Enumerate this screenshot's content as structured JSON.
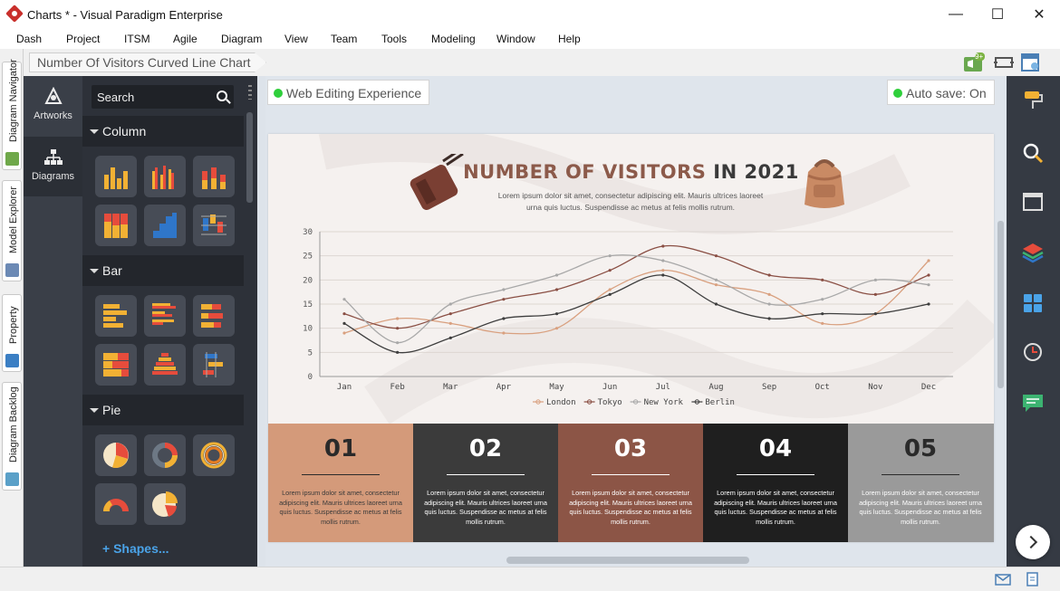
{
  "window": {
    "title": "Charts * - Visual Paradigm Enterprise"
  },
  "menu": [
    "Dash",
    "Project",
    "ITSM",
    "Agile",
    "Diagram",
    "View",
    "Team",
    "Tools",
    "Modeling",
    "Window",
    "Help"
  ],
  "left_tabs": [
    "Diagram Navigator",
    "Model Explorer",
    "Property",
    "Diagram Backlog"
  ],
  "breadcrumb": "Number Of Visitors Curved Line Chart",
  "toolbar": {
    "notification_badge": "9+"
  },
  "side_nav": [
    {
      "label": "Artworks",
      "icon": "artworks-icon"
    },
    {
      "label": "Diagrams",
      "icon": "diagrams-icon",
      "active": true
    }
  ],
  "search": {
    "placeholder": "Search"
  },
  "categories": [
    {
      "name": "Column",
      "tiles": 6
    },
    {
      "name": "Bar",
      "tiles": 6
    },
    {
      "name": "Pie",
      "tiles": 5
    }
  ],
  "shapes_link": "Shapes...",
  "status": {
    "web_editing": "Web Editing Experience",
    "autosave": "Auto save: On"
  },
  "infographic": {
    "title_main": "NUMBER OF VISITORS",
    "title_year": "IN 2021",
    "subtitle": "Lorem ipsum dolor sit amet, consectetur adipiscing elit. Mauris ultrices laoreet urna quis luctus. Suspendisse ac metus at felis mollis rutrum.",
    "cards": [
      {
        "number": "01",
        "text": "Lorem ipsum dolor sit amet, consectetur adipiscing elit. Mauris ultrices laoreet urna quis luctus. Suspendisse ac metus at felis mollis rutrum.",
        "bg": "#d49a7a",
        "fg": "#2a2a2a",
        "body": "#3a3a3a"
      },
      {
        "number": "02",
        "text": "Lorem ipsum dolor sit amet, consectetur adipiscing elit. Mauris ultrices laoreet urna quis luctus. Suspendisse ac metus at felis mollis rutrum.",
        "bg": "#3b3b3b",
        "fg": "#ffffff",
        "body": "#ffffff"
      },
      {
        "number": "03",
        "text": "Lorem ipsum dolor sit amet, consectetur adipiscing elit. Mauris ultrices laoreet urna quis luctus. Suspendisse ac metus at felis mollis rutrum.",
        "bg": "#8c5546",
        "fg": "#ffffff",
        "body": "#ffffff"
      },
      {
        "number": "04",
        "text": "Lorem ipsum dolor sit amet, consectetur adipiscing elit. Mauris ultrices laoreet urna quis luctus. Suspendisse ac metus at felis mollis rutrum.",
        "bg": "#1f1f1f",
        "fg": "#ffffff",
        "body": "#ffffff"
      },
      {
        "number": "05",
        "text": "Lorem ipsum dolor sit amet, consectetur adipiscing elit. Mauris ultrices laoreet urna quis luctus. Suspendisse ac metus at felis mollis rutrum.",
        "bg": "#9a9a9a",
        "fg": "#2a2a2a",
        "body": "#ffffff"
      }
    ]
  },
  "chart_data": {
    "type": "line",
    "categories": [
      "Jan",
      "Feb",
      "Mar",
      "Apr",
      "May",
      "Jun",
      "Jul",
      "Aug",
      "Sep",
      "Oct",
      "Nov",
      "Dec"
    ],
    "ylim": [
      0,
      30
    ],
    "yticks": [
      0,
      5,
      10,
      15,
      20,
      25,
      30
    ],
    "grid": true,
    "legend": "bottom",
    "series": [
      {
        "name": "London",
        "color": "#d9a07f",
        "values": [
          9,
          12,
          11,
          9,
          10,
          18,
          22,
          19,
          17,
          11,
          13,
          24
        ]
      },
      {
        "name": "Tokyo",
        "color": "#8a4f44",
        "values": [
          13,
          10,
          13,
          16,
          18,
          22,
          27,
          25,
          21,
          20,
          17,
          21
        ]
      },
      {
        "name": "New York",
        "color": "#a8a8a8",
        "values": [
          16,
          7,
          15,
          18,
          21,
          25,
          24,
          20,
          15,
          16,
          20,
          19
        ]
      },
      {
        "name": "Berlin",
        "color": "#3e3e3e",
        "values": [
          11,
          5,
          8,
          12,
          13,
          17,
          21,
          15,
          12,
          13,
          13,
          15
        ]
      }
    ]
  }
}
